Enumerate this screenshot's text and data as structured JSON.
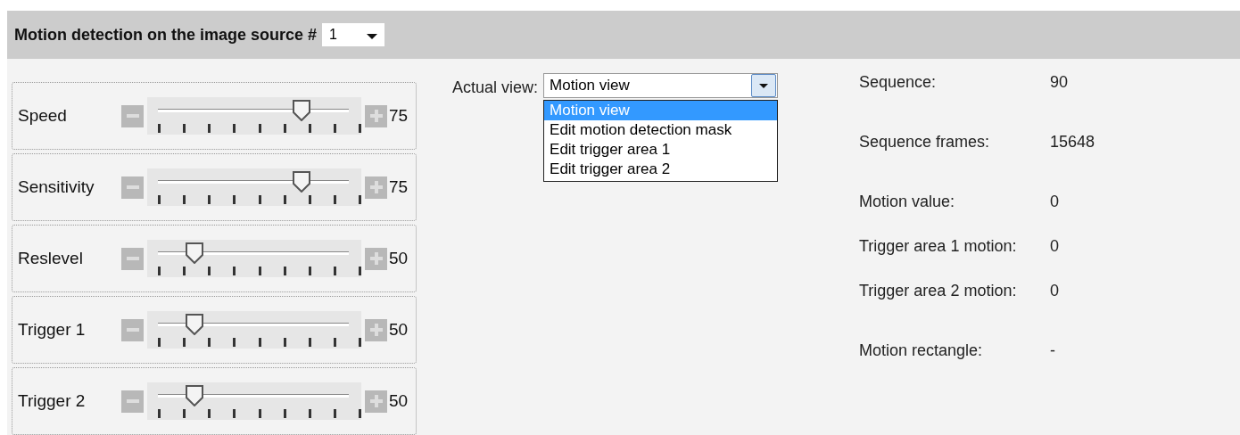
{
  "header": {
    "title": "Motion detection on the image source #",
    "source_select": {
      "value": "1"
    }
  },
  "sliders": [
    {
      "label": "Speed",
      "level": 0.75,
      "reading": "75"
    },
    {
      "label": "Sensitivity",
      "level": 0.75,
      "reading": "75"
    },
    {
      "label": "Reslevel",
      "level": 0.19,
      "reading": "50"
    },
    {
      "label": "Trigger 1",
      "level": 0.19,
      "reading": "50"
    },
    {
      "label": "Trigger 2",
      "level": 0.19,
      "reading": "50"
    }
  ],
  "view": {
    "label": "Actual view:",
    "value": "Motion view",
    "options": [
      {
        "label": "Motion view",
        "selected": true
      },
      {
        "label": "Edit motion detection mask",
        "selected": false
      },
      {
        "label": "Edit trigger area 1",
        "selected": false
      },
      {
        "label": "Edit trigger area 2",
        "selected": false
      }
    ]
  },
  "stats": [
    {
      "label": "Sequence:",
      "value": "90"
    },
    {
      "label": "Sequence frames:",
      "value": "15648"
    },
    {
      "label": "Motion value:",
      "value": "0"
    },
    {
      "label": "Trigger area 1 motion:",
      "value": "0"
    },
    {
      "label": "Trigger area 2 motion:",
      "value": "0"
    },
    {
      "label": "Motion rectangle:",
      "value": "-"
    }
  ]
}
